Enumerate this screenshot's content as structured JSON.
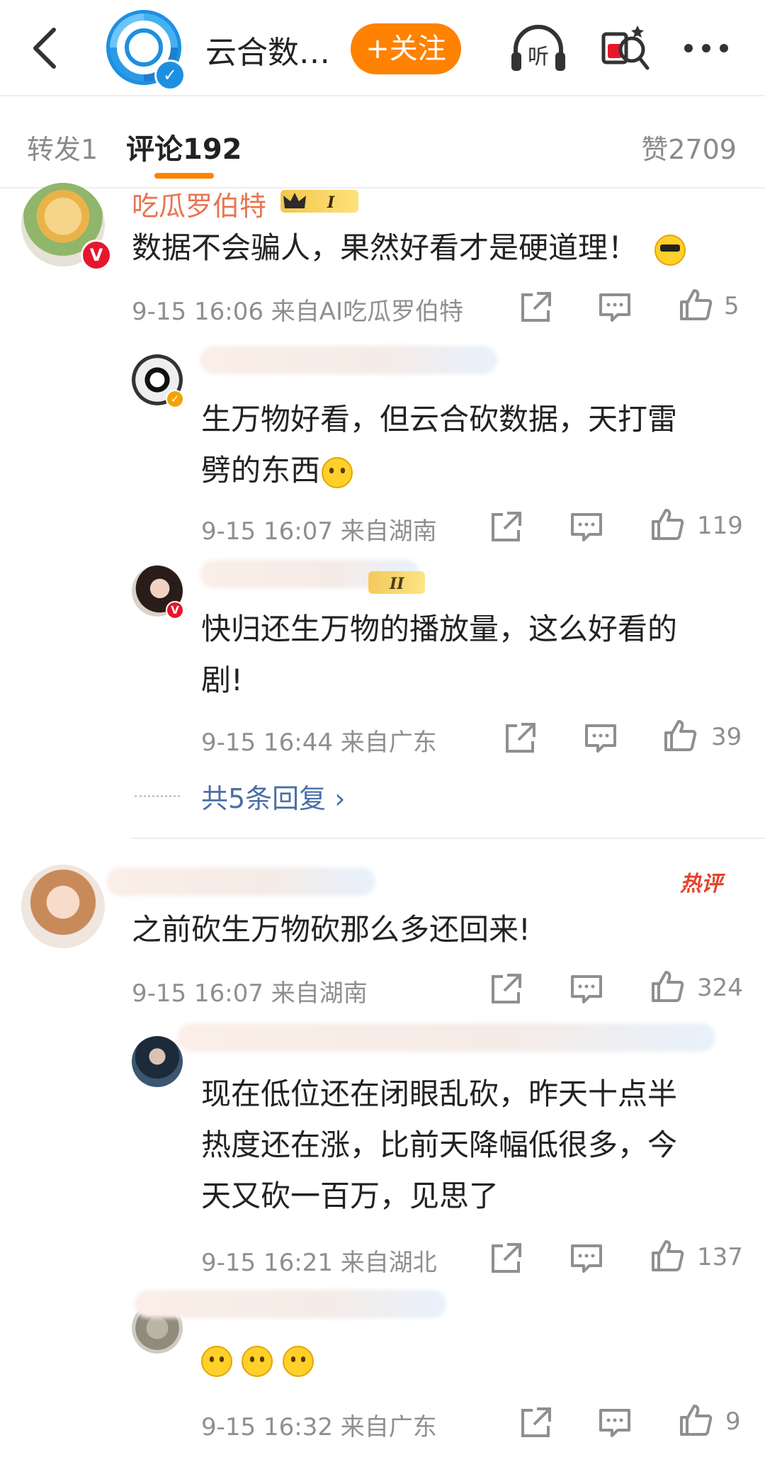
{
  "header": {
    "title": "云合数…",
    "follow_label": "+关注",
    "icons": [
      "back-icon",
      "verified-badge-icon",
      "listen-icon",
      "red-packet-icon",
      "more-icon"
    ]
  },
  "tabs": {
    "repost": "转发1",
    "comments": "评论192",
    "likes": "赞2709"
  },
  "comments": [
    {
      "user": "吃瓜罗伯特",
      "text": "数据不会骗人，果然好看才是硬道理！",
      "time": "9-15 16:06",
      "source": "来自AI吃瓜罗伯特",
      "likes": "5"
    },
    {
      "text": "之前砍生万物砍那么多还回来!",
      "time": "9-15 16:07",
      "source": "来自湖南",
      "likes": "324",
      "badge": "热评"
    }
  ],
  "replies": [
    {
      "text_line1": "生万物好看，但云合砍数据，天打雷",
      "text_line2": "劈的东西",
      "time": "9-15 16:07",
      "source": "来自湖南",
      "likes": "119"
    },
    {
      "text_line1": "快归还生万物的播放量，这么好看的",
      "text_line2": "剧!",
      "time": "9-15 16:44",
      "source": "来自广东",
      "likes": "39"
    },
    {
      "text_line1": "现在低位还在闭眼乱砍，昨天十点半",
      "text_line2": "热度还在涨，比前天降幅低很多，今",
      "text_line3": "天又砍一百万，见思了",
      "time": "9-15 16:21",
      "source": "来自湖北",
      "likes": "137"
    },
    {
      "time": "9-15 16:32",
      "source": "来自广东",
      "likes": "9"
    }
  ],
  "more_replies": "共5条回复 ›",
  "colors": {
    "accent": "#ff8200",
    "username": "#eb7350",
    "link": "#4a6fa8",
    "meta": "#8f8f8f"
  }
}
